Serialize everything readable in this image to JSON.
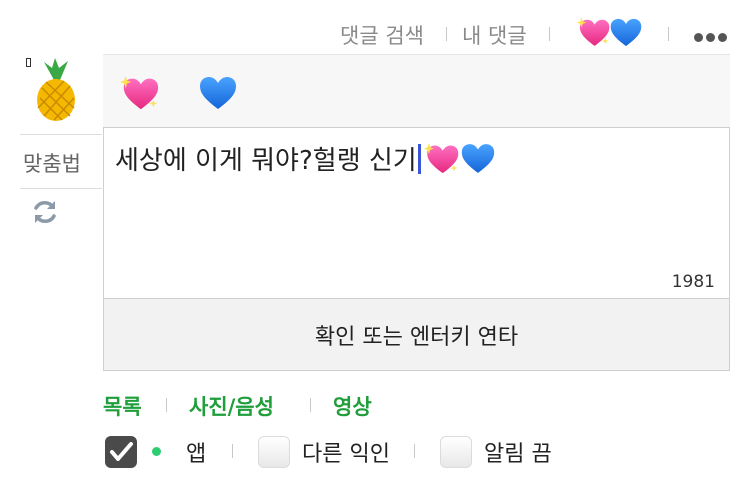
{
  "top": {
    "search_comments": "댓글 검색",
    "my_comments": "내 댓글",
    "emoji_icons": [
      "sparkling-heart-icon",
      "blue-heart-icon"
    ],
    "more_icon": "more-dots-icon"
  },
  "sidebar": {
    "avatar_icon": "pineapple-icon",
    "spellcheck_label": "맞춤법",
    "refresh_icon": "refresh-icon"
  },
  "emoji_strip": {
    "items": [
      "sparkling-heart-icon",
      "blue-heart-icon"
    ]
  },
  "editor": {
    "text": "세상에 이게 뭐야?헐랭 신기",
    "trailing_emojis": [
      "sparkling-heart-icon",
      "blue-heart-icon"
    ],
    "char_count": "1981"
  },
  "submit": {
    "label": "확인 또는 엔터키 연타"
  },
  "tabs": [
    {
      "label": "목록"
    },
    {
      "label": "사진/음성"
    },
    {
      "label": "영상"
    }
  ],
  "options": {
    "app_label": "앱",
    "app_checked": true,
    "other_anon_label": "다른 익인",
    "other_anon_checked": false,
    "notify_off_label": "알림 끔",
    "notify_off_checked": false
  },
  "colors": {
    "tab_green": "#1f9e3b",
    "online_green": "#2ecc71",
    "caret_blue": "#3b55d9"
  }
}
